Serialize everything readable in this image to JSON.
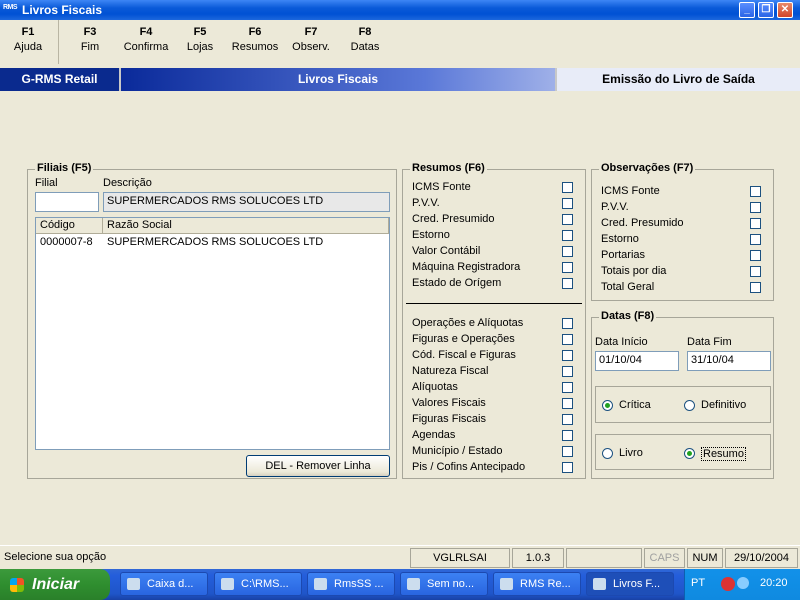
{
  "window": {
    "logo": "RMS",
    "title": "Livros Fiscais"
  },
  "fkeys": [
    {
      "key": "F1",
      "label": "Ajuda"
    },
    {
      "key": "F3",
      "label": "Fim"
    },
    {
      "key": "F4",
      "label": "Confirma"
    },
    {
      "key": "F5",
      "label": "Lojas"
    },
    {
      "key": "F6",
      "label": "Resumos"
    },
    {
      "key": "F7",
      "label": "Observ."
    },
    {
      "key": "F8",
      "label": "Datas"
    }
  ],
  "header": {
    "app": "G-RMS Retail",
    "module": "Livros Fiscais",
    "screen": "Emissão do Livro de Saída"
  },
  "filiais": {
    "title": "Filiais (F5)",
    "filial_label": "Filial",
    "filial_value": "",
    "descricao_label": "Descrição",
    "descricao_value": "SUPERMERCADOS RMS SOLUCOES LTD",
    "columns": [
      "Código",
      "Razão Social"
    ],
    "rows": [
      {
        "codigo": "0000007-8",
        "razao": "SUPERMERCADOS RMS SOLUCOES LTD"
      }
    ],
    "remove_button": "DEL - Remover Linha"
  },
  "resumos": {
    "title": "Resumos (F6)",
    "group1": [
      "ICMS Fonte",
      "P.V.V.",
      "Cred. Presumido",
      "Estorno",
      "Valor Contábil",
      "Máquina Registradora",
      "Estado de Orígem"
    ],
    "group2": [
      "Operações e Alíquotas",
      "Figuras e Operações",
      "Cód. Fiscal e Figuras",
      "Natureza Fiscal",
      "Alíquotas",
      "Valores Fiscais",
      "Figuras Fiscais",
      "Agendas",
      "Município / Estado",
      "Pis / Cofins Antecipado"
    ]
  },
  "observacoes": {
    "title": "Observações (F7)",
    "items": [
      "ICMS Fonte",
      "P.V.V.",
      "Cred. Presumido",
      "Estorno",
      "Portarias",
      "Totais por dia",
      "Total Geral"
    ]
  },
  "datas": {
    "title": "Datas (F8)",
    "inicio_label": "Data Início",
    "inicio_value": "01/10/04",
    "fim_label": "Data Fim",
    "fim_value": "31/10/04",
    "tipo": {
      "critica": "Crítica",
      "definitivo": "Definitivo",
      "selected": "Crítica"
    },
    "saida": {
      "livro": "Livro",
      "resumo": "Resumo",
      "selected": "Resumo"
    }
  },
  "status": {
    "message": "Selecione sua opção",
    "program": "VGLRLSAI",
    "version": "1.0.3",
    "caps": "CAPS",
    "num": "NUM",
    "date": "29/10/2004"
  },
  "taskbar": {
    "start": "Iniciar",
    "tasks": [
      "Caixa d...",
      "C:\\RMS...",
      "RmsSS ...",
      "Sem no...",
      "RMS Re...",
      "Livros F..."
    ],
    "lang": "PT",
    "time": "20:20"
  }
}
